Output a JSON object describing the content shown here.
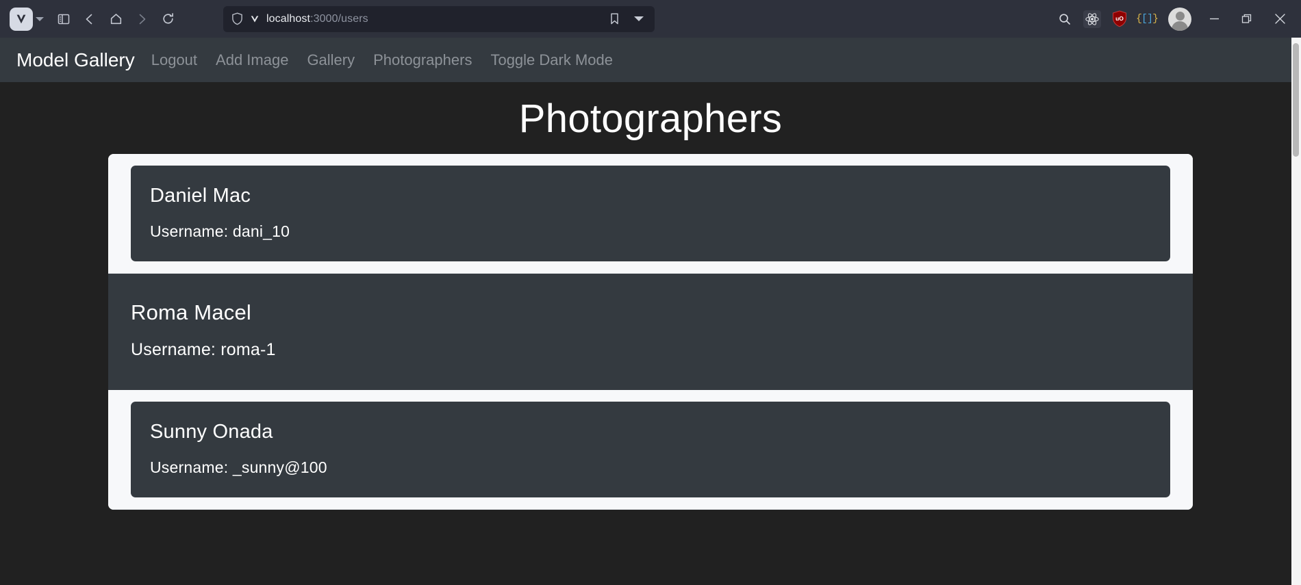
{
  "browser": {
    "name": "Vivaldi",
    "toolbar_icons": [
      {
        "name": "vivaldi-menu-icon",
        "label": "V"
      },
      {
        "name": "panel-toggle-icon",
        "label": "Panels"
      },
      {
        "name": "back-icon",
        "label": "Back"
      },
      {
        "name": "home-icon",
        "label": "Home"
      },
      {
        "name": "forward-icon",
        "label": "Forward"
      },
      {
        "name": "reload-icon",
        "label": "Reload"
      }
    ],
    "urlbar": {
      "shield_icon": "shield-icon",
      "site_icon": "vivaldi-favicon",
      "url_host": "localhost",
      "url_path": ":3000/users",
      "full_url": "localhost:3000/users",
      "bookmark_icon": "bookmark-icon",
      "dropdown_icon": "chevron-down-icon"
    },
    "right_icons": [
      {
        "name": "search-icon",
        "label": "Search"
      },
      {
        "name": "react-devtools-icon",
        "label": "React Developer Tools"
      },
      {
        "name": "ublock-origin-icon",
        "label": "uO"
      },
      {
        "name": "json-viewer-icon",
        "label": "{[]}"
      },
      {
        "name": "profile-avatar",
        "label": "Profile"
      }
    ],
    "window_controls": [
      {
        "name": "minimize-button",
        "label": "—"
      },
      {
        "name": "maximize-button",
        "label": "Restore"
      },
      {
        "name": "close-button",
        "label": "✕"
      }
    ]
  },
  "navbar": {
    "brand": "Model Gallery",
    "links": [
      {
        "label": "Logout"
      },
      {
        "label": "Add Image"
      },
      {
        "label": "Gallery"
      },
      {
        "label": "Photographers"
      },
      {
        "label": "Toggle Dark Mode"
      }
    ]
  },
  "main": {
    "title": "Photographers",
    "username_label": "Username:",
    "photographers": [
      {
        "name": "Daniel Mac",
        "username_line": "Username: dani_10",
        "hovered": false
      },
      {
        "name": "Roma Macel",
        "username_line": "Username: roma-1",
        "hovered": true
      },
      {
        "name": "Sunny Onada",
        "username_line": "Username: _sunny@100",
        "hovered": false
      }
    ]
  },
  "colors": {
    "chrome_bg": "#2e313c",
    "urlbar_bg": "#20222c",
    "navbar_bg": "#343a40",
    "page_bg": "#212121",
    "list_bg": "#f7f8fa",
    "card_bg": "#343a40",
    "text_light": "#ffffff",
    "nav_link": "#8d9298",
    "ublock_red": "#8f0000"
  }
}
